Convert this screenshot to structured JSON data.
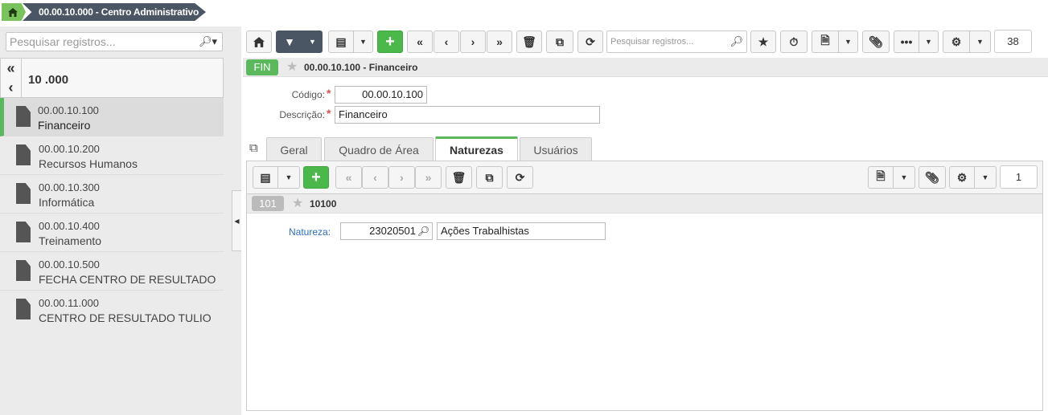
{
  "breadcrumb": {
    "item": "00.00.10.000 - Centro Administrativo"
  },
  "left": {
    "search_placeholder": "Pesquisar registros...",
    "tree_title": "10 .000",
    "items": [
      {
        "code": "00.00.10.100",
        "name": "Financeiro"
      },
      {
        "code": "00.00.10.200",
        "name": "Recursos Humanos"
      },
      {
        "code": "00.00.10.300",
        "name": "Informática"
      },
      {
        "code": "00.00.10.400",
        "name": "Treinamento"
      },
      {
        "code": "00.00.10.500",
        "name": "FECHA CENTRO DE RESULTADO"
      },
      {
        "code": "00.00.11.000",
        "name": "CENTRO DE RESULTADO TULIO"
      }
    ]
  },
  "toolbar": {
    "search_placeholder": "Pesquisar registros...",
    "count": "38"
  },
  "record": {
    "badge": "FIN",
    "title": "00.00.10.100 - Financeiro",
    "codigo_label": "Código:",
    "codigo_value": "00.00.10.100",
    "descricao_label": "Descrição:",
    "descricao_value": "Financeiro"
  },
  "tabs": [
    {
      "label": "Geral"
    },
    {
      "label": "Quadro de Área"
    },
    {
      "label": "Naturezas"
    },
    {
      "label": "Usuários"
    }
  ],
  "subrecord": {
    "count": "1",
    "badge": "101",
    "title": "10100",
    "natureza_label": "Natureza:",
    "natureza_code": "23020501",
    "natureza_desc": "Ações Trabalhistas"
  },
  "colors": {
    "accent_green": "#5cb85c",
    "dark": "#4a5663"
  }
}
